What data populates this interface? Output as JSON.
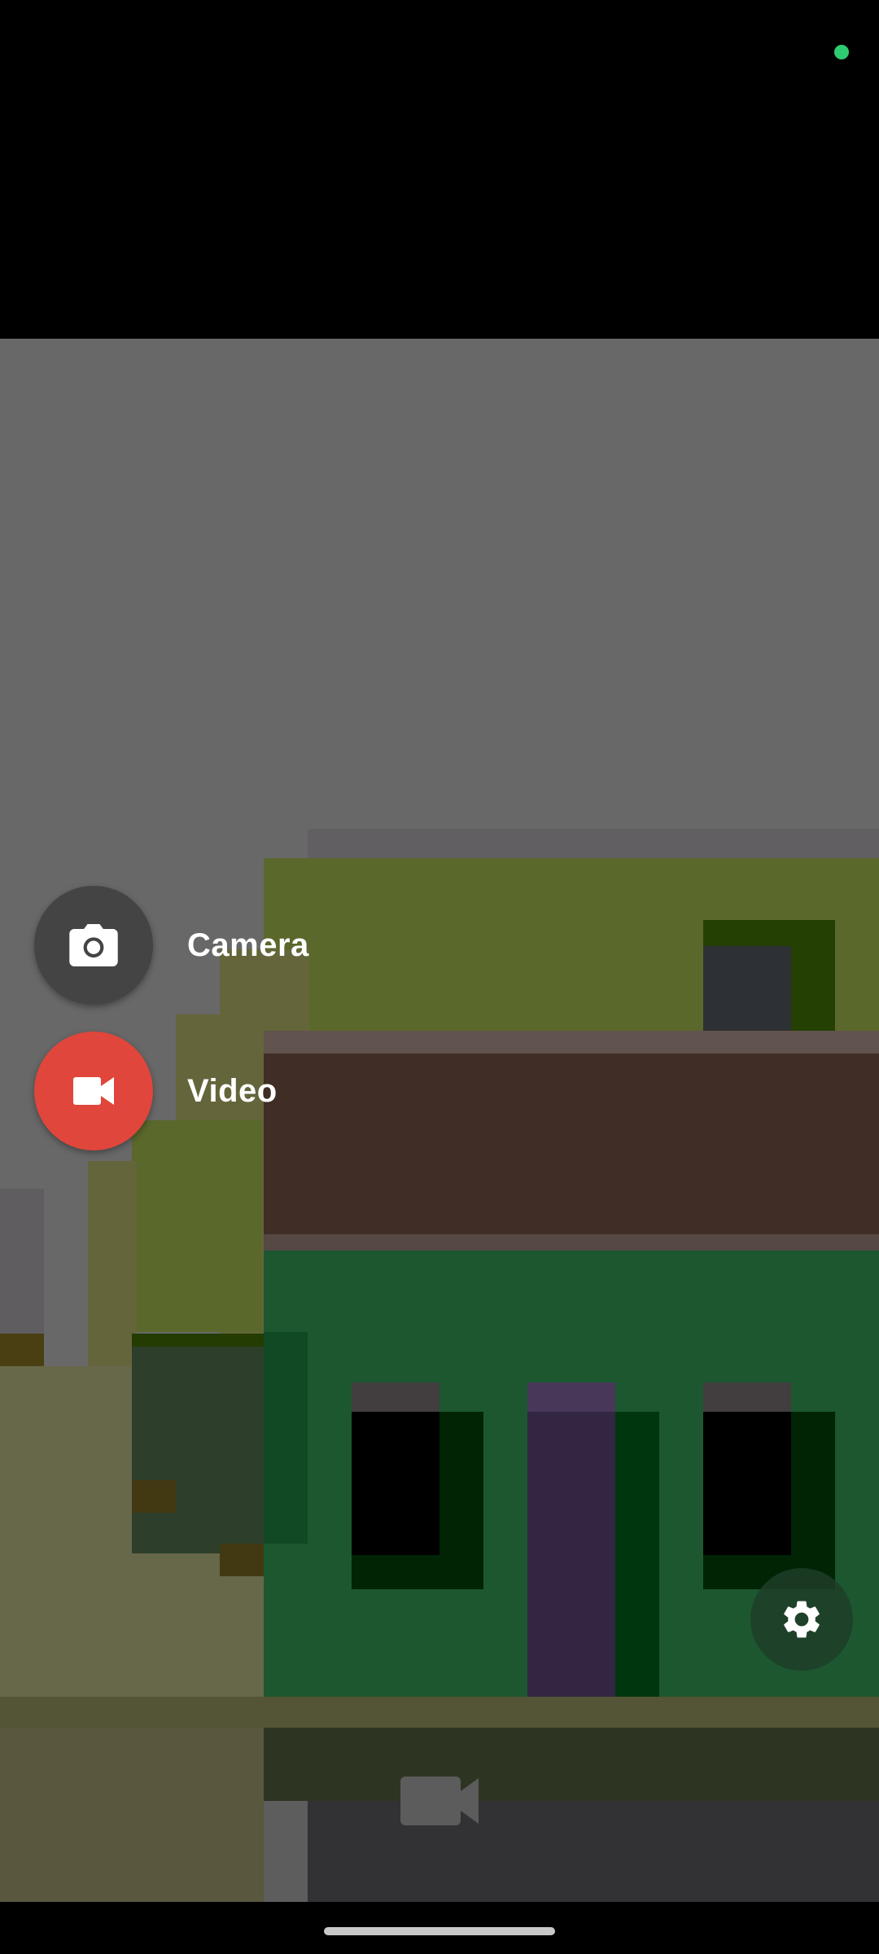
{
  "status_bar": {
    "privacy_indicator_color": "#2ecc71"
  },
  "menu": {
    "camera": {
      "label": "Camera",
      "icon": "camera-icon",
      "fab_color": "#444444"
    },
    "video": {
      "label": "Video",
      "icon": "videocam-icon",
      "fab_color": "#E0463B"
    }
  },
  "settings": {
    "icon": "settings-gear-icon",
    "fab_color": "#1e3d28"
  },
  "shutter": {
    "icon": "video-record-icon"
  },
  "navigation": {
    "handle_color": "#c8c8c8"
  }
}
